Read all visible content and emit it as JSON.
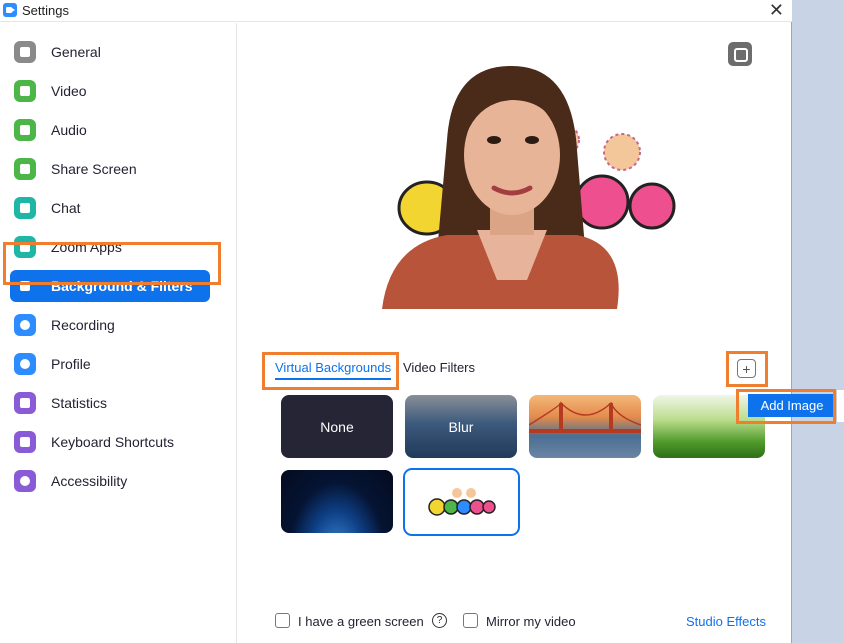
{
  "window": {
    "title": "Settings"
  },
  "sidebar": {
    "items": [
      {
        "label": "General",
        "icon": "gear-icon",
        "color": "#8a8a8a"
      },
      {
        "label": "Video",
        "icon": "video-camera-icon",
        "color": "#4cb648"
      },
      {
        "label": "Audio",
        "icon": "headphones-icon",
        "color": "#4cb648"
      },
      {
        "label": "Share Screen",
        "icon": "share-screen-icon",
        "color": "#4cb648"
      },
      {
        "label": "Chat",
        "icon": "chat-bubble-icon",
        "color": "#1fb6a5"
      },
      {
        "label": "Zoom Apps",
        "icon": "apps-icon",
        "color": "#1fb6a5"
      },
      {
        "label": "Background & Filters",
        "icon": "person-badge-icon",
        "color": "#0e72ed"
      },
      {
        "label": "Recording",
        "icon": "record-icon",
        "color": "#2d8cff"
      },
      {
        "label": "Profile",
        "icon": "profile-icon",
        "color": "#2d8cff"
      },
      {
        "label": "Statistics",
        "icon": "bar-chart-icon",
        "color": "#8a5bd6"
      },
      {
        "label": "Keyboard Shortcuts",
        "icon": "keyboard-icon",
        "color": "#8a5bd6"
      },
      {
        "label": "Accessibility",
        "icon": "accessibility-icon",
        "color": "#8a5bd6"
      }
    ],
    "active": "Background & Filters"
  },
  "tabs": {
    "virtual_backgrounds": "Virtual Backgrounds",
    "video_filters": "Video Filters"
  },
  "add_menu": {
    "add_image": "Add Image"
  },
  "thumbnails": {
    "none": "None",
    "blur": "Blur"
  },
  "footer": {
    "green_screen": "I have a green screen",
    "mirror": "Mirror my video",
    "studio_effects": "Studio Effects",
    "help": "?"
  },
  "colors": {
    "accent": "#0e72ed",
    "highlight": "#ef7f2e"
  }
}
